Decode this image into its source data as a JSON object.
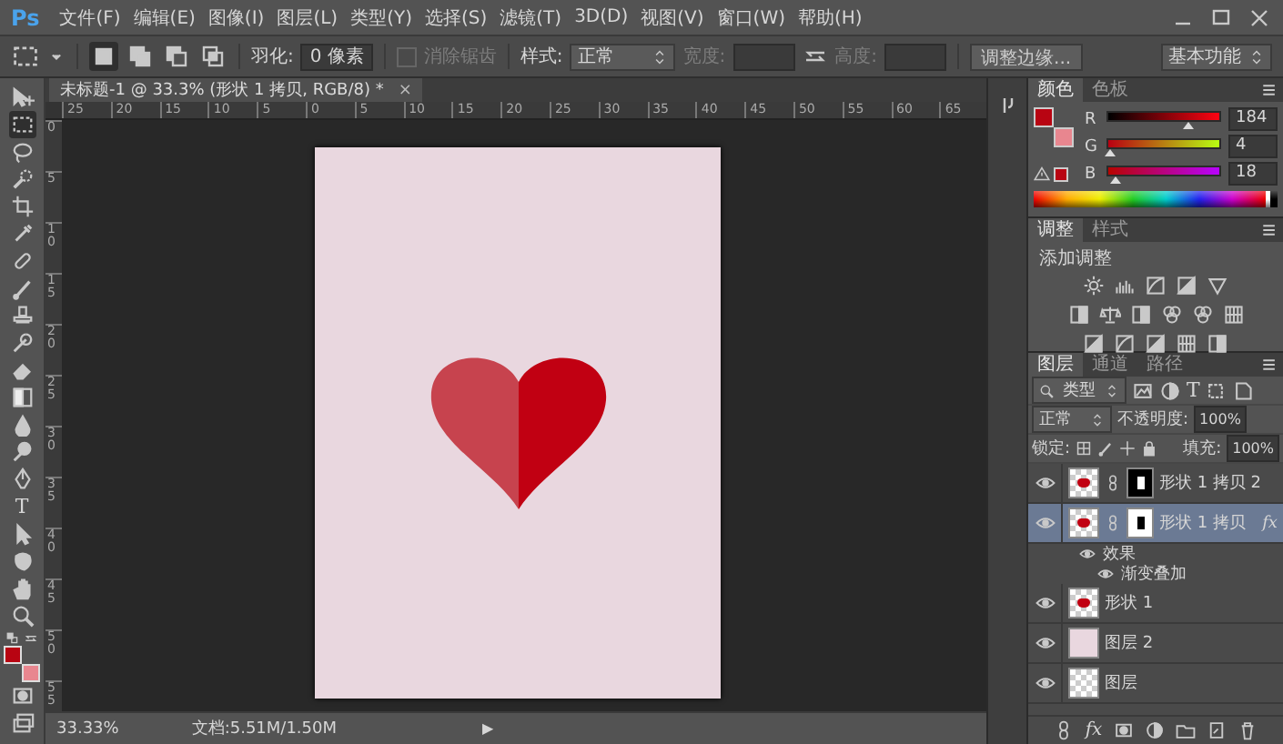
{
  "app": {
    "logo": "Ps"
  },
  "menu": [
    "文件(F)",
    "编辑(E)",
    "图像(I)",
    "图层(L)",
    "类型(Y)",
    "选择(S)",
    "滤镜(T)",
    "3D(D)",
    "视图(V)",
    "窗口(W)",
    "帮助(H)"
  ],
  "options_bar": {
    "modes": [
      {
        "selected": true
      },
      {
        "selected": false
      },
      {
        "selected": false
      },
      {
        "selected": false
      }
    ],
    "feather_label": "羽化:",
    "feather_value": "0 像素",
    "antialias": {
      "label": "消除锯齿",
      "checked": false,
      "disabled": true
    },
    "style_label": "样式:",
    "style_value": "正常",
    "width_label": "宽度:",
    "height_label": "高度:",
    "refine_button": "调整边缘...",
    "workspace": "基本功能"
  },
  "tools": [
    {
      "kind": "move",
      "selected": false
    },
    {
      "kind": "marquee",
      "selected": true
    },
    {
      "kind": "lasso",
      "selected": false
    },
    {
      "kind": "quick",
      "selected": false
    },
    {
      "kind": "crop",
      "selected": false
    },
    {
      "kind": "eyedropper",
      "selected": false
    },
    {
      "kind": "bandage",
      "selected": false
    },
    {
      "kind": "brush",
      "selected": false
    },
    {
      "kind": "stamp",
      "selected": false
    },
    {
      "kind": "history",
      "selected": false
    },
    {
      "kind": "eraser",
      "selected": false
    },
    {
      "kind": "gradient",
      "selected": false
    },
    {
      "kind": "drop",
      "selected": false
    },
    {
      "kind": "dodge",
      "selected": false
    },
    {
      "kind": "pen",
      "selected": false
    },
    {
      "kind": "type",
      "selected": false,
      "glyph": "T"
    },
    {
      "kind": "pointer",
      "selected": false
    },
    {
      "kind": "shape",
      "selected": false
    },
    {
      "kind": "hand",
      "selected": false
    },
    {
      "kind": "zoom",
      "selected": false
    }
  ],
  "swatches": [
    {
      "kind": "foreground",
      "color": "#b80412"
    },
    {
      "kind": "background",
      "color": "#e8868f"
    }
  ],
  "document_tab": {
    "title": "未标题-1 @ 33.3% (形状 1 拷贝, RGB/8) *",
    "close": "×"
  },
  "rulers": {
    "horizontal": [
      "25",
      "20",
      "15",
      "10",
      "5",
      "0",
      "5",
      "10",
      "15",
      "20",
      "25",
      "30",
      "35",
      "40",
      "45",
      "50",
      "55",
      "60",
      "65"
    ],
    "vertical": [
      "0",
      "5",
      "10",
      "15",
      "20",
      "25",
      "30",
      "35",
      "40",
      "45",
      "50",
      "55"
    ]
  },
  "status_bar": {
    "zoom": "33.33%",
    "doc_info": "文档:5.51M/1.50M",
    "arrow": "▶"
  },
  "color_panel": {
    "tabs": [
      {
        "label": "颜色",
        "selected": true
      },
      {
        "label": "色板",
        "selected": false
      }
    ],
    "channels": [
      {
        "name": "R",
        "value": "184",
        "level": 0.72
      },
      {
        "name": "G",
        "value": "4",
        "level": 0.016
      },
      {
        "name": "B",
        "value": "18",
        "level": 0.07
      }
    ]
  },
  "adjustments_panel": {
    "tabs": [
      {
        "label": "调整",
        "selected": true
      },
      {
        "label": "样式",
        "selected": false
      }
    ],
    "heading": "添加调整"
  },
  "layers_panel": {
    "tabs": [
      {
        "label": "图层",
        "selected": true
      },
      {
        "label": "通道",
        "selected": false
      },
      {
        "label": "路径",
        "selected": false
      }
    ],
    "filter": "类型",
    "filter_glyph": "T",
    "blend_mode": "正常",
    "opacity_label": "不透明度:",
    "opacity": "100%",
    "lock_label": "锁定:",
    "fill_label": "填充:",
    "fill": "100%",
    "layers": [
      {
        "name": "形状 1 拷贝 2",
        "kind": "mask_dark",
        "visible": true,
        "selected": false
      },
      {
        "name": "形状 1 拷贝",
        "kind": "mask_light",
        "visible": true,
        "selected": true,
        "badge": "fx",
        "children": [
          {
            "label": "效果",
            "visible": true,
            "children": [
              {
                "label": "渐变叠加",
                "visible": true
              }
            ]
          }
        ]
      },
      {
        "name": "形状 1",
        "kind": "shape",
        "visible": true,
        "selected": false
      },
      {
        "name": "图层 2",
        "kind": "fill",
        "visible": true,
        "selected": false
      },
      {
        "name": "图层",
        "kind": "empty",
        "visible": true,
        "selected": false
      }
    ],
    "footer_fx": "fx"
  }
}
